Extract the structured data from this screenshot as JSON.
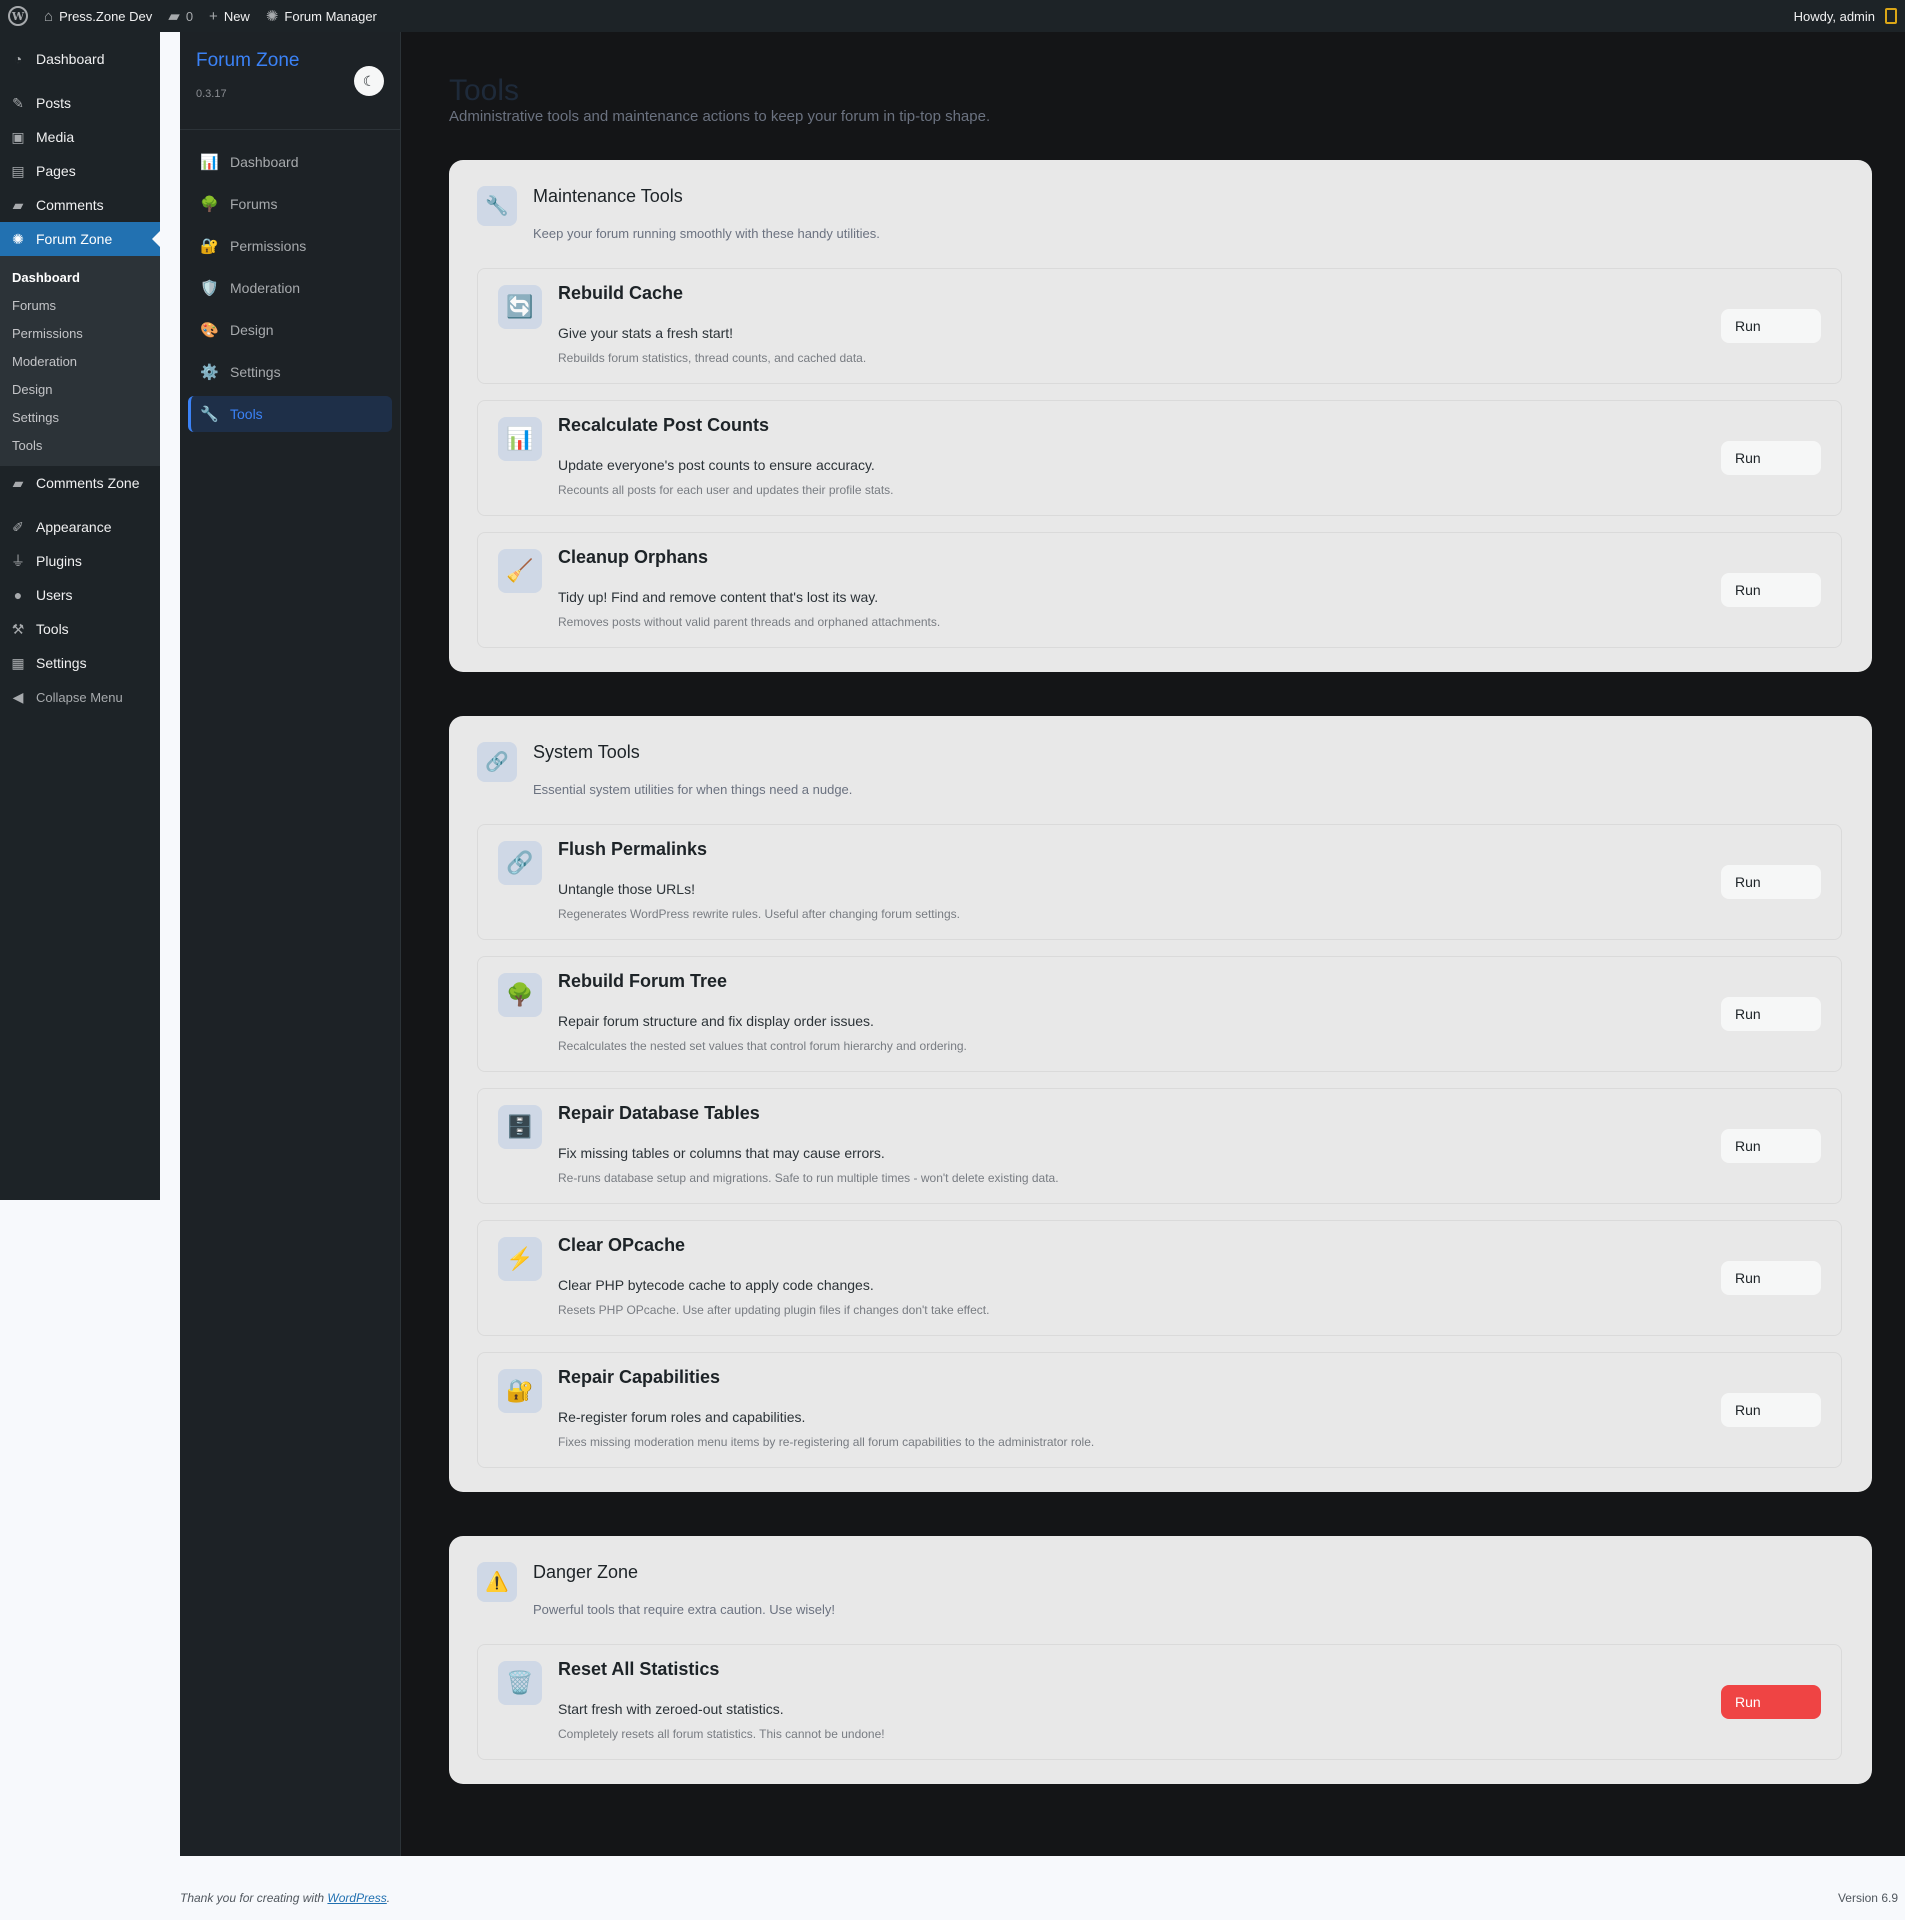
{
  "admin_bar": {
    "site_name": "Press.Zone Dev",
    "comments_count": "0",
    "new_label": "New",
    "forum_manager_label": "Forum Manager",
    "howdy": "Howdy, admin"
  },
  "wp_menu": {
    "dashboard": "Dashboard",
    "posts": "Posts",
    "media": "Media",
    "pages": "Pages",
    "comments": "Comments",
    "forum_zone": "Forum Zone",
    "forum_zone_sub": [
      "Dashboard",
      "Forums",
      "Permissions",
      "Moderation",
      "Design",
      "Settings",
      "Tools"
    ],
    "comments_zone": "Comments Zone",
    "appearance": "Appearance",
    "plugins": "Plugins",
    "users": "Users",
    "tools": "Tools",
    "settings": "Settings",
    "collapse": "Collapse Menu"
  },
  "app": {
    "brand": "Forum Zone",
    "version": "0.3.17",
    "nav": [
      {
        "label": "Dashboard",
        "icon": "chart-icon",
        "glyph": "📊"
      },
      {
        "label": "Forums",
        "icon": "tree-icon",
        "glyph": "🌳"
      },
      {
        "label": "Permissions",
        "icon": "lock-icon",
        "glyph": "🔐"
      },
      {
        "label": "Moderation",
        "icon": "shield-icon",
        "glyph": "🛡️"
      },
      {
        "label": "Design",
        "icon": "palette-icon",
        "glyph": "🎨"
      },
      {
        "label": "Settings",
        "icon": "gear-icon",
        "glyph": "⚙️"
      },
      {
        "label": "Tools",
        "icon": "wrench-icon",
        "glyph": "🔧"
      }
    ]
  },
  "page": {
    "title": "Tools",
    "description": "Administrative tools and maintenance actions to keep your forum in tip-top shape."
  },
  "sections": [
    {
      "title": "Maintenance Tools",
      "description": "Keep your forum running smoothly with these handy utilities.",
      "icon": "wrench-icon",
      "glyph": "🔧",
      "tools": [
        {
          "title": "Rebuild Cache",
          "subtitle": "Give your stats a fresh start!",
          "detail": "Rebuilds forum statistics, thread counts, and cached data.",
          "icon": "refresh-icon",
          "glyph": "🔄",
          "run": "Run"
        },
        {
          "title": "Recalculate Post Counts",
          "subtitle": "Update everyone's post counts to ensure accuracy.",
          "detail": "Recounts all posts for each user and updates their profile stats.",
          "icon": "bar-chart-icon",
          "glyph": "📊",
          "run": "Run"
        },
        {
          "title": "Cleanup Orphans",
          "subtitle": "Tidy up! Find and remove content that's lost its way.",
          "detail": "Removes posts without valid parent threads and orphaned attachments.",
          "icon": "broom-icon",
          "glyph": "🧹",
          "run": "Run"
        }
      ]
    },
    {
      "title": "System Tools",
      "description": "Essential system utilities for when things need a nudge.",
      "icon": "link-icon",
      "glyph": "🔗",
      "tools": [
        {
          "title": "Flush Permalinks",
          "subtitle": "Untangle those URLs!",
          "detail": "Regenerates WordPress rewrite rules. Useful after changing forum settings.",
          "icon": "link-icon",
          "glyph": "🔗",
          "run": "Run"
        },
        {
          "title": "Rebuild Forum Tree",
          "subtitle": "Repair forum structure and fix display order issues.",
          "detail": "Recalculates the nested set values that control forum hierarchy and ordering.",
          "icon": "tree-icon",
          "glyph": "🌳",
          "run": "Run"
        },
        {
          "title": "Repair Database Tables",
          "subtitle": "Fix missing tables or columns that may cause errors.",
          "detail": "Re-runs database setup and migrations. Safe to run multiple times - won't delete existing data.",
          "icon": "cabinet-icon",
          "glyph": "🗄️",
          "run": "Run"
        },
        {
          "title": "Clear OPcache",
          "subtitle": "Clear PHP bytecode cache to apply code changes.",
          "detail": "Resets PHP OPcache. Use after updating plugin files if changes don't take effect.",
          "icon": "lightning-icon",
          "glyph": "⚡",
          "run": "Run"
        },
        {
          "title": "Repair Capabilities",
          "subtitle": "Re-register forum roles and capabilities.",
          "detail": "Fixes missing moderation menu items by re-registering all forum capabilities to the administrator role.",
          "icon": "lock-icon",
          "glyph": "🔐",
          "run": "Run"
        }
      ]
    },
    {
      "title": "Danger Zone",
      "description": "Powerful tools that require extra caution. Use wisely!",
      "icon": "warning-icon",
      "glyph": "⚠️",
      "tools": [
        {
          "title": "Reset All Statistics",
          "subtitle": "Start fresh with zeroed-out statistics.",
          "detail": "Completely resets all forum statistics. This cannot be undone!",
          "icon": "trash-icon",
          "glyph": "🗑️",
          "run": "Run",
          "danger": true
        }
      ]
    }
  ],
  "footer": {
    "thanks": "Thank you for creating with",
    "link": "WordPress",
    "version": "Version 6.9"
  },
  "colors": {
    "accent": "#3b82f6",
    "danger": "#ef4444",
    "wp_blue": "#2271b1"
  }
}
